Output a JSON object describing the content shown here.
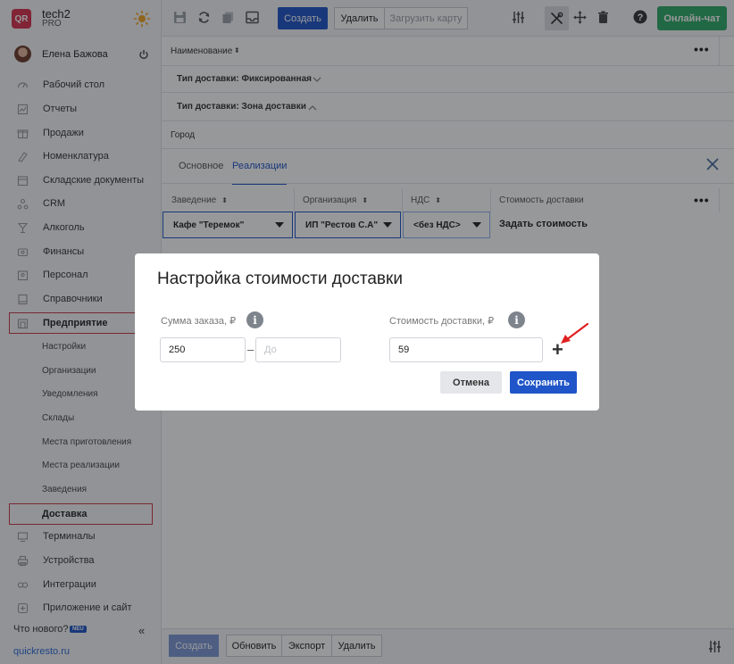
{
  "sidebar": {
    "logo_text": "QR",
    "org_name": "tech2",
    "org_plan": "PRO",
    "user_name": "Елена Бажова",
    "items": [
      {
        "label": "Рабочий стол",
        "icon": "dashboard-icon"
      },
      {
        "label": "Отчеты",
        "icon": "reports-icon"
      },
      {
        "label": "Продажи",
        "icon": "sales-icon"
      },
      {
        "label": "Номенклатура",
        "icon": "catalog-icon"
      },
      {
        "label": "Складские документы",
        "icon": "warehouse-icon"
      },
      {
        "label": "CRM",
        "icon": "crm-icon"
      },
      {
        "label": "Алкоголь",
        "icon": "alcohol-icon"
      },
      {
        "label": "Финансы",
        "icon": "finance-icon"
      },
      {
        "label": "Персонал",
        "icon": "staff-icon"
      },
      {
        "label": "Справочники",
        "icon": "references-icon"
      },
      {
        "label": "Предприятие",
        "icon": "enterprise-icon"
      }
    ],
    "subitems": [
      "Настройки",
      "Организации",
      "Уведомления",
      "Склады",
      "Места приготовления",
      "Места реализации",
      "Заведения",
      "Доставка"
    ],
    "items_after": [
      {
        "label": "Терминалы",
        "icon": "terminal-icon"
      },
      {
        "label": "Устройства",
        "icon": "printer-icon"
      },
      {
        "label": "Интеграции",
        "icon": "integrations-icon"
      },
      {
        "label": "Приложение и сайт",
        "icon": "app-icon"
      }
    ],
    "whats_new": "Что нового?",
    "new_badge": "NEU",
    "site_link": "quickresto.ru"
  },
  "toolbar": {
    "create": "Создать",
    "delete": "Удалить",
    "load_map": "Загрузить карту",
    "online_chat": "Онлайн-чат"
  },
  "content": {
    "name_header": "Наименование",
    "group_fixed": "Тип доставки: Фиксированная",
    "group_zone": "Тип доставки: Зона доставки",
    "city": "Город",
    "tabs": [
      "Основное",
      "Реализации"
    ],
    "active_tab": "Реализации",
    "columns": [
      "Заведение",
      "Организация",
      "НДС",
      "Стоимость доставки"
    ],
    "row": {
      "venue": "Кафе \"Теремок\"",
      "organization": "ИП \"Рестов С.А\"",
      "vat": "<без НДС>",
      "cost": "Задать стоимость"
    }
  },
  "bottombar": {
    "create": "Создать",
    "refresh": "Обновить",
    "export": "Экспорт",
    "delete": "Удалить"
  },
  "modal": {
    "title": "Настройка стоимости доставки",
    "order_sum_label": "Сумма заказа, ₽",
    "order_from_value": "250",
    "order_to_placeholder": "До",
    "delivery_cost_label": "Стоимость доставки, ₽",
    "delivery_cost_value": "59",
    "info_glyph": "i",
    "add_glyph": "+",
    "cancel": "Отмена",
    "save": "Сохранить"
  },
  "colors": {
    "primary": "#1f55c8",
    "accent_green": "#2eaa67",
    "highlight_red": "#c83a48",
    "logo": "#d6314e"
  }
}
